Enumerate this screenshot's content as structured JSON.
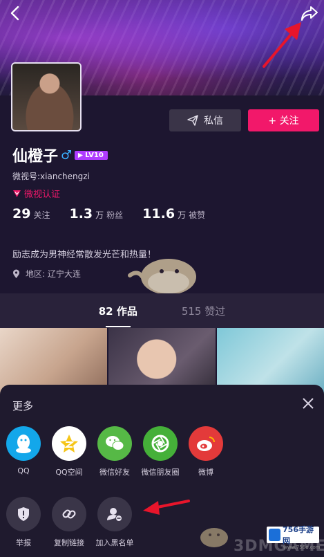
{
  "profile": {
    "name": "仙橙子",
    "gender_symbol": "♂",
    "level_badge": "LV10",
    "weishi_id": "微视号:xianchengzi",
    "verified_text": "微视认证",
    "bio": "励志成为男神经常散发光芒和热量！",
    "location": "地区: 辽宁大连"
  },
  "actions": {
    "message_label": "私信",
    "follow_label": "+ 关注"
  },
  "stats": [
    {
      "num": "29",
      "unit": "",
      "label": "关注"
    },
    {
      "num": "1.3",
      "unit": "万",
      "label": "粉丝"
    },
    {
      "num": "11.6",
      "unit": "万",
      "label": "被赞"
    }
  ],
  "tabs": [
    {
      "label": "82 作品",
      "active": true
    },
    {
      "label": "515 赞过",
      "active": false
    }
  ],
  "sheet": {
    "title": "更多",
    "share_items": [
      {
        "label": "QQ",
        "icon": "qq-icon"
      },
      {
        "label": "QQ空间",
        "icon": "qzone-icon"
      },
      {
        "label": "微信好友",
        "icon": "wechat-icon"
      },
      {
        "label": "微信朋友圈",
        "icon": "moments-icon"
      },
      {
        "label": "微博",
        "icon": "weibo-icon"
      }
    ],
    "action_items": [
      {
        "label": "举报",
        "icon": "report-shield-icon"
      },
      {
        "label": "复制链接",
        "icon": "link-icon"
      },
      {
        "label": "加入黑名单",
        "icon": "block-user-icon"
      }
    ]
  },
  "watermark": {
    "text": "3DMGAME",
    "badge_text": "756手游网",
    "badge_sub": "www.756e.com"
  },
  "colors": {
    "accent": "#f2186a",
    "background": "#1d1630",
    "sheet": "#1f1a2e",
    "annotation_arrow": "#e8152b"
  }
}
